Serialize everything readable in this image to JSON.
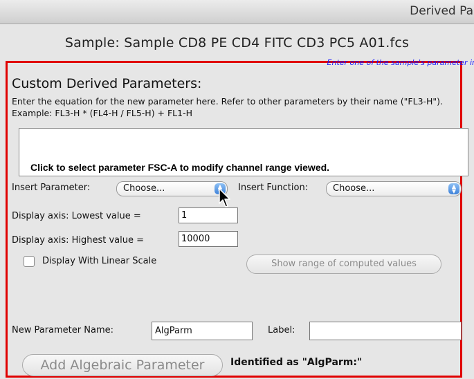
{
  "window": {
    "title": "Derived Par"
  },
  "sample": {
    "text": "Sample: Sample CD8 PE CD4 FITC CD3 PC5 A01.fcs"
  },
  "hint": {
    "text": "Enter one of the sample's parameter in"
  },
  "custom": {
    "title": "Custom Derived Parameters:",
    "description": "Enter the equation for the new parameter here.  Refer to other parameters by their name (\"FL3-H\").  Example:  FL3-H * (FL4-H / FL5-H) + FL1-H",
    "equation_value": ""
  },
  "tooltip": {
    "text": "Click to select parameter FSC-A to modify channel range viewed."
  },
  "insert_parameter": {
    "label": "Insert Parameter:",
    "selected": "Choose..."
  },
  "insert_function": {
    "label": "Insert Function:",
    "selected": "Choose..."
  },
  "display_axis": {
    "lowest_label": "Display axis: Lowest value =",
    "lowest_value": "1",
    "highest_label": "Display axis: Highest value =",
    "highest_value": "10000"
  },
  "linear_scale": {
    "label": "Display With Linear Scale",
    "checked": false
  },
  "show_range_button": {
    "label": "Show range of computed values"
  },
  "new_param": {
    "label": "New Parameter Name:",
    "value": "AlgParm"
  },
  "label_field": {
    "label": "Label:",
    "value": ""
  },
  "add_button": {
    "label": "Add Algebraic Parameter"
  },
  "identified": {
    "text": "Identified as \"AlgParm:\""
  },
  "colors": {
    "highlight_border": "#e00000",
    "hint_text": "#1a1aff",
    "stepper": "#3f82d9"
  }
}
